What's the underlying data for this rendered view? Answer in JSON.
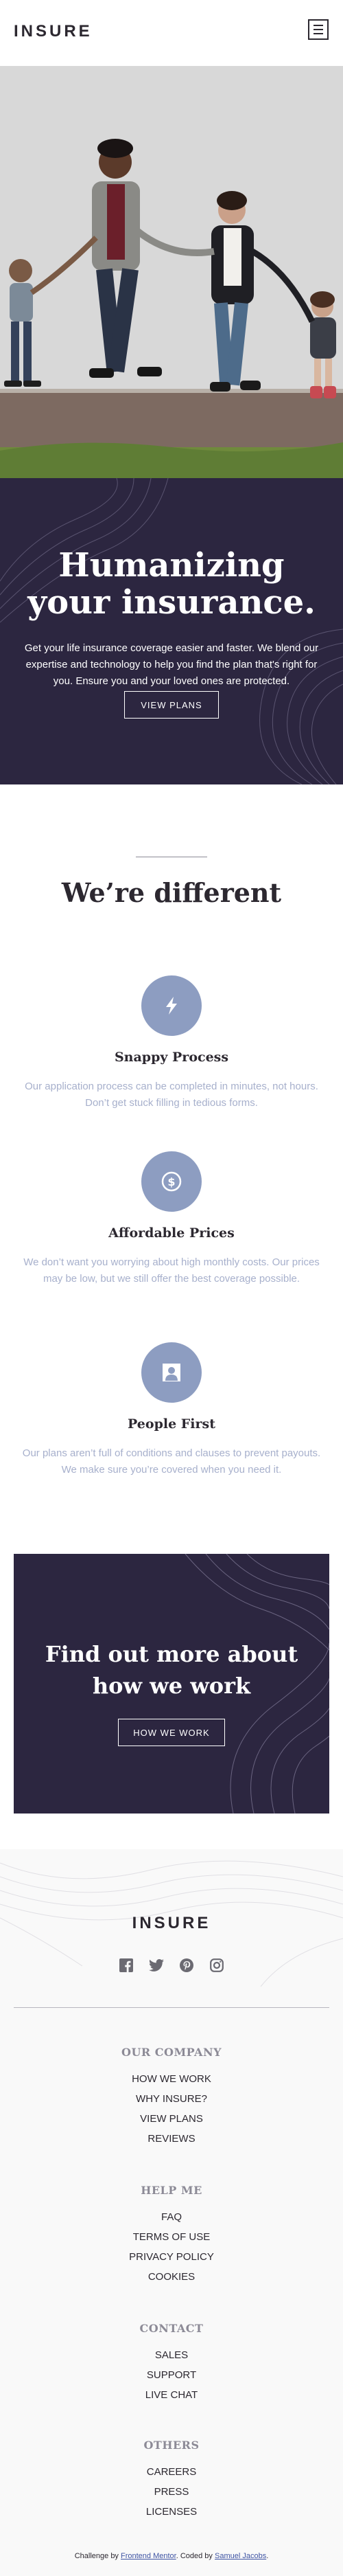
{
  "header": {
    "logo": "INSURE",
    "menu_icon": "hamburger-menu-icon"
  },
  "hero": {
    "photo_description_icon": "family-photo",
    "title": "Humanizing your insurance.",
    "text": "Get your life insurance coverage easier and faster. We blend our expertise and technology to help you find the plan that's right for you. Ensure you and your loved ones are protected.",
    "button": "VIEW PLANS"
  },
  "different": {
    "title": "We’re different",
    "features": [
      {
        "icon": "lightning-bolt-icon",
        "title": "Snappy Process",
        "text": "Our application process can be completed in minutes, not hours. Don’t get stuck filling in tedious forms."
      },
      {
        "icon": "dollar-coin-icon",
        "title": "Affordable Prices",
        "text": "We don’t want you worrying about high monthly costs. Our prices may be low, but we still offer the best coverage possible."
      },
      {
        "icon": "person-icon",
        "title": "People First",
        "text": "Our plans aren’t full of conditions and clauses to prevent payouts. We make sure you’re covered when you need it."
      }
    ]
  },
  "cta": {
    "title": "Find out more about how we work",
    "button": "HOW WE WORK"
  },
  "footer": {
    "logo": "INSURE",
    "socials": [
      "facebook-icon",
      "twitter-icon",
      "pinterest-icon",
      "instagram-icon"
    ],
    "groups": [
      {
        "title": "OUR COMPANY",
        "links": [
          "HOW WE WORK",
          "WHY INSURE?",
          "VIEW PLANS",
          "REVIEWS"
        ]
      },
      {
        "title": "HELP ME",
        "links": [
          "FAQ",
          "TERMS OF USE",
          "PRIVACY POLICY",
          "COOKIES"
        ]
      },
      {
        "title": "CONTACT",
        "links": [
          "SALES",
          "SUPPORT",
          "LIVE CHAT"
        ]
      },
      {
        "title": "OTHERS",
        "links": [
          "CAREERS",
          "PRESS",
          "LICENSES"
        ]
      }
    ],
    "credit": {
      "prefix": "Challenge by",
      "link1": "Frontend Mentor",
      "middle": ". Coded by",
      "link2": "Samuel Jacobs",
      "suffix": "."
    }
  },
  "colors": {
    "dark_violet": "#2c2640",
    "grayish_blue": "#8d9dc1",
    "light_text": "#a7b0cc",
    "footer_bg": "#f9f9f9"
  }
}
